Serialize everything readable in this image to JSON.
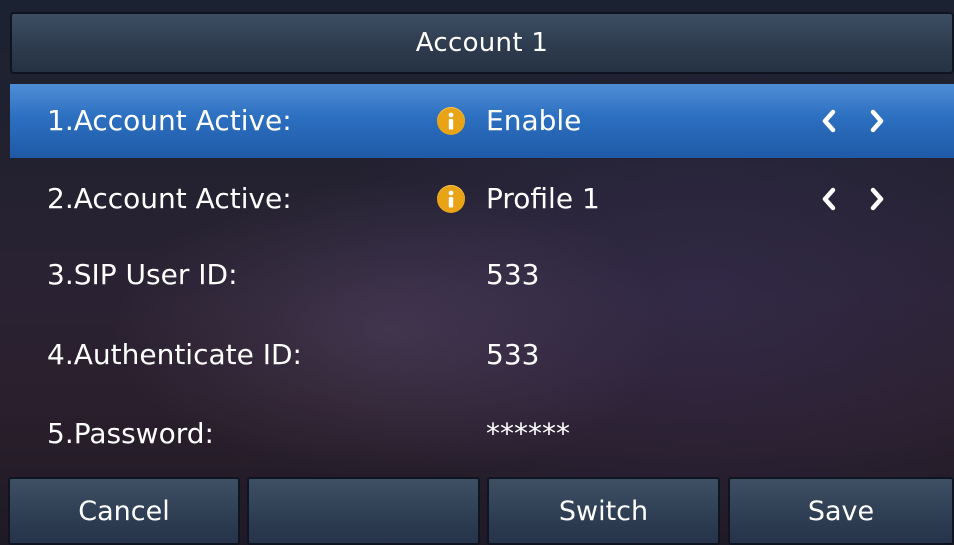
{
  "header": {
    "title": "Account 1"
  },
  "rows": [
    {
      "label": "1.Account Active:",
      "value": "Enable",
      "info_icon": "info-icon",
      "has_arrows": true,
      "selected": true
    },
    {
      "label": "2.Account Active:",
      "value": "Profile 1",
      "info_icon": "info-icon",
      "has_arrows": true,
      "selected": false
    },
    {
      "label": "3.SIP User ID:",
      "value": "533",
      "has_arrows": false,
      "selected": false
    },
    {
      "label": "4.Authenticate ID:",
      "value": "533",
      "has_arrows": false,
      "selected": false
    },
    {
      "label": "5.Password:",
      "value": "******",
      "has_arrows": false,
      "selected": false
    }
  ],
  "softkeys": [
    {
      "label": "Cancel"
    },
    {
      "label": ""
    },
    {
      "label": "Switch"
    },
    {
      "label": "Save"
    }
  ],
  "colors": {
    "selected_row": "#2c6fc0",
    "info_icon": "#e8a317",
    "bar_background": "#304055",
    "text": "#ffffff"
  }
}
